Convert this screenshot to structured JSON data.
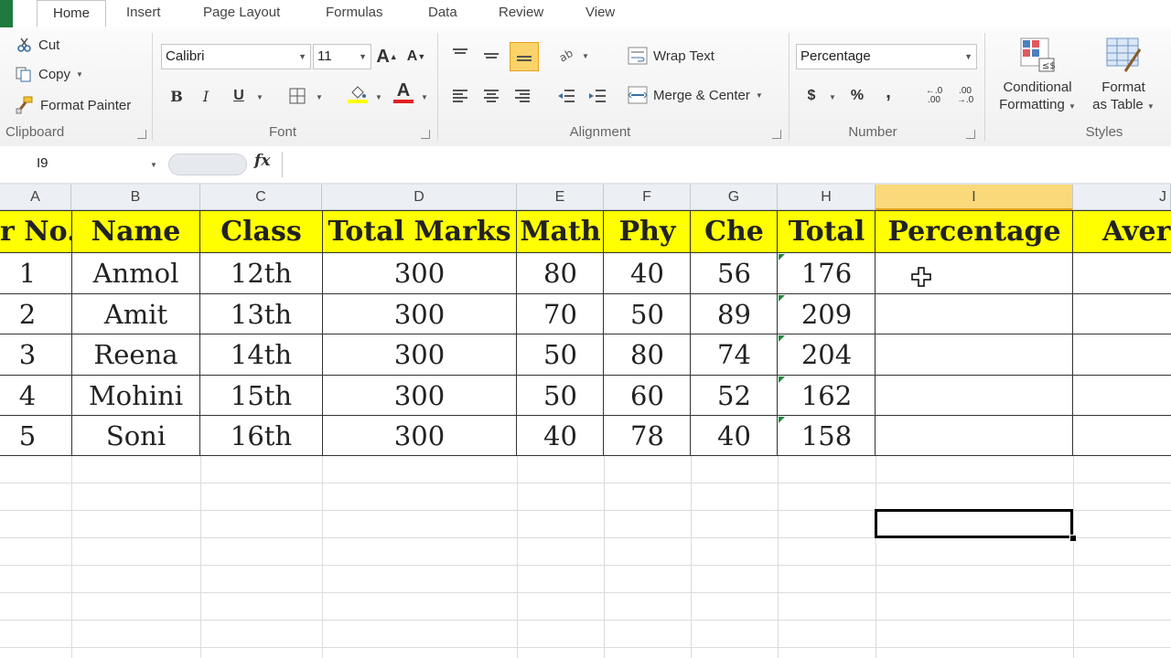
{
  "tabs": [
    "Home",
    "Insert",
    "Page Layout",
    "Formulas",
    "Data",
    "Review",
    "View"
  ],
  "clipboard": {
    "cut": "Cut",
    "copy": "Copy",
    "format_painter": "Format Painter",
    "label": "Clipboard"
  },
  "font": {
    "name": "Calibri",
    "size": "11",
    "label": "Font"
  },
  "alignment": {
    "wrap_text": "Wrap Text",
    "merge_center": "Merge & Center",
    "label": "Alignment"
  },
  "number": {
    "format": "Percentage",
    "currency": "$",
    "percent": "%",
    "comma": ",",
    "label": "Number"
  },
  "styles": {
    "conditional_line1": "Conditional",
    "conditional_line2": "Formatting",
    "format_table_line1": "Format",
    "format_table_line2": "as Table",
    "label": "Styles"
  },
  "formula_bar": {
    "name_box": "I9",
    "fx": "fx",
    "formula": ""
  },
  "columns": [
    "A",
    "B",
    "C",
    "D",
    "E",
    "F",
    "G",
    "H",
    "I",
    "J"
  ],
  "table": {
    "headers": [
      "r No.",
      "Name",
      "Class",
      "Total Marks",
      "Math",
      "Phy",
      "Che",
      "Total",
      "Percentage",
      "Aver"
    ],
    "rows": [
      [
        "1",
        "Anmol",
        "12th",
        "300",
        "80",
        "40",
        "56",
        "176",
        "",
        ""
      ],
      [
        "2",
        "Amit",
        "13th",
        "300",
        "70",
        "50",
        "89",
        "209",
        "",
        ""
      ],
      [
        "3",
        "Reena",
        "14th",
        "300",
        "50",
        "80",
        "74",
        "204",
        "",
        ""
      ],
      [
        "4",
        "Mohini",
        "15th",
        "300",
        "50",
        "60",
        "52",
        "162",
        "",
        ""
      ],
      [
        "5",
        "Soni",
        "16th",
        "300",
        "40",
        "78",
        "40",
        "158",
        "",
        ""
      ]
    ]
  },
  "colors": {
    "header_fill": "#ffff00",
    "selection": "#000000",
    "accent": "#1e7a3c"
  }
}
